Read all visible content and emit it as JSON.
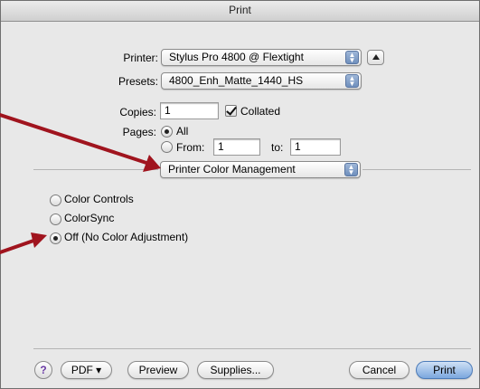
{
  "window": {
    "title": "Print"
  },
  "printer": {
    "label": "Printer:",
    "value": "Stylus Pro 4800 @ Flextight"
  },
  "presets": {
    "label": "Presets:",
    "value": "4800_Enh_Matte_1440_HS"
  },
  "copies": {
    "label": "Copies:",
    "value": "1",
    "collated_label": "Collated",
    "collated_checked": true
  },
  "pages": {
    "label": "Pages:",
    "all_label": "All",
    "from_label": "From:",
    "from_value": "1",
    "to_label": "to:",
    "to_value": "1",
    "selected": "All"
  },
  "panel_popup": {
    "value": "Printer Color Management"
  },
  "color_management": {
    "options": [
      {
        "label": "Color Controls",
        "selected": false
      },
      {
        "label": "ColorSync",
        "selected": false
      },
      {
        "label": "Off (No Color Adjustment)",
        "selected": true
      }
    ]
  },
  "footer": {
    "help_label": "?",
    "pdf_label": "PDF ▾",
    "preview_label": "Preview",
    "supplies_label": "Supplies...",
    "cancel_label": "Cancel",
    "print_label": "Print"
  },
  "colors": {
    "annotation_arrow": "#a0141e",
    "default_button": "#7ba7de"
  }
}
